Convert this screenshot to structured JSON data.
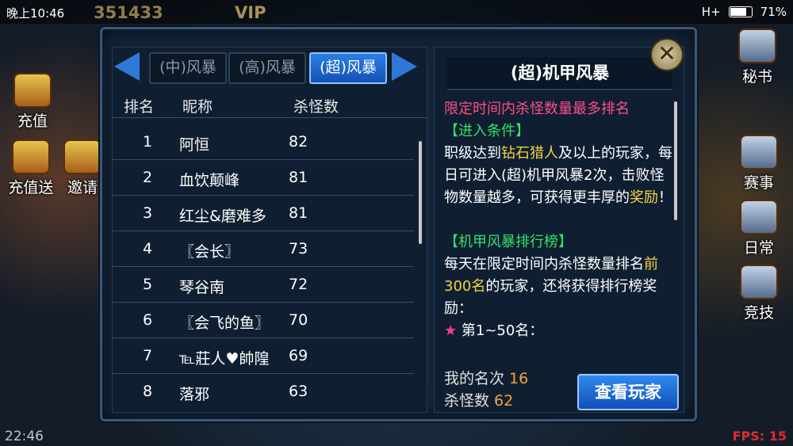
{
  "status_bar": {
    "time": "晚上10:46",
    "network": "H+",
    "battery": "71%"
  },
  "hud": {
    "coins": "351433",
    "vip": "VIP"
  },
  "side_left": [
    "充值",
    "充值送",
    "邀请"
  ],
  "side_right": [
    "秘书",
    "赛事",
    "日常",
    "竞技"
  ],
  "bottom": {
    "clock": "22:46",
    "fps": "FPS: 15"
  },
  "tabs": [
    {
      "label": "(中)风暴",
      "active": false
    },
    {
      "label": "(高)风暴",
      "active": false
    },
    {
      "label": "(超)风暴",
      "active": true
    }
  ],
  "table": {
    "headers": {
      "rank": "排名",
      "name": "昵称",
      "kills": "杀怪数"
    },
    "rows": [
      {
        "rank": "1",
        "name": "阿恒",
        "kills": "82"
      },
      {
        "rank": "2",
        "name": "血饮颠峰",
        "kills": "81"
      },
      {
        "rank": "3",
        "name": "红尘&磨难多",
        "kills": "81"
      },
      {
        "rank": "4",
        "name": "〖会长〗",
        "kills": "73"
      },
      {
        "rank": "5",
        "name": "琴谷南",
        "kills": "72"
      },
      {
        "rank": "6",
        "name": "〖会飞的鱼〗",
        "kills": "70"
      },
      {
        "rank": "7",
        "name": "℡莊人♥帥隍",
        "kills": "69"
      },
      {
        "rank": "8",
        "name": "落邪",
        "kills": "63"
      }
    ]
  },
  "details": {
    "title": "(超)机甲风暴",
    "subtitle": "限定时间内杀怪数量最多排名",
    "entry_heading": "【进入条件】",
    "entry_text_1": "职级达到",
    "entry_highlight": "钻石猎人",
    "entry_text_2": "及以上的玩家，每日可进入(超)机甲风暴2次，击败怪物数量越多，可获得更丰厚的",
    "entry_reward": "奖励",
    "entry_text_3": "！",
    "rank_heading": "【机甲风暴排行榜】",
    "rank_text_1": "每天在限定时间内杀怪数量排名",
    "rank_highlight": "前300名",
    "rank_text_2": "的玩家，还将获得排行榜奖励：",
    "rank_item": "第1~50名："
  },
  "me": {
    "rank_label": "我的名次",
    "rank_value": "16",
    "kills_label": "杀怪数",
    "kills_value": "62"
  },
  "view_button": "查看玩家",
  "colors": {
    "accent": "#2f78d8",
    "highlight": "#f5d342",
    "heading": "#35e06a",
    "subtitle": "#ff4d8a"
  }
}
